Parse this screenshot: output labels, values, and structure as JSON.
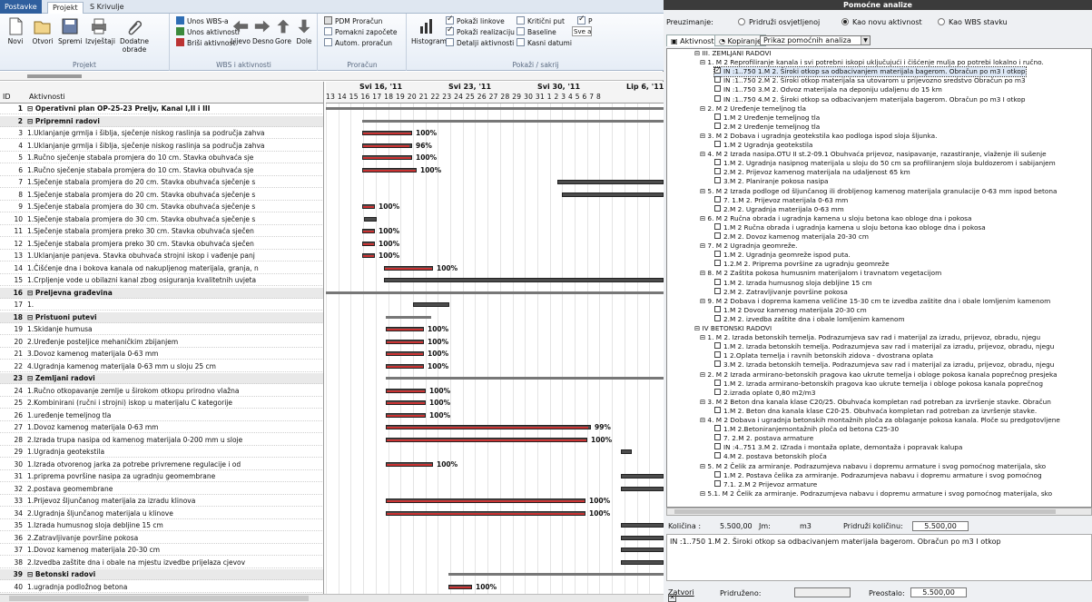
{
  "ribbon": {
    "tabs": [
      "Postavke",
      "Projekt",
      "S Krivulje"
    ],
    "groups": {
      "projekt": {
        "label": "Projekt",
        "buttons": [
          "Novi",
          "Otvori",
          "Spremi",
          "Izvještaji",
          "Dodatne obrade"
        ]
      },
      "wbs": {
        "label": "WBS i aktivnosti",
        "small": [
          "Unos WBS-a",
          "Unos aktivnosti",
          "Briši aktivnost"
        ],
        "buttons": [
          "Lijevo",
          "Desno",
          "Gore",
          "Dole"
        ]
      },
      "proracun": {
        "label": "Proračun",
        "small": [
          "PDM Proračun",
          "Pomakni započete",
          "Autom. proračun"
        ]
      },
      "prikazi": {
        "label": "Pokaži / sakrij",
        "histogram": "Histogram",
        "checks": [
          {
            "label": "Pokaži linkove",
            "on": true
          },
          {
            "label": "Kritični put",
            "on": false
          },
          {
            "label": "P",
            "on": true
          },
          {
            "label": "Pokaži realizaciju",
            "on": true
          },
          {
            "label": "Baseline",
            "on": false
          },
          {
            "label": "Detalji aktivnosti",
            "on": false
          },
          {
            "label": "Kasni datumi",
            "on": false
          }
        ],
        "truncated": "Sve a"
      }
    }
  },
  "grid": {
    "col_id": "ID",
    "col_name": "Aktivnosti",
    "weeks": [
      "Svi 16, '11",
      "Svi 23, '11",
      "Svi 30, '11",
      "Lip 6, '11"
    ],
    "days": "13 14 15 16 17 18 19 20 21 22 23 24 25 26 27 28 29 30 31 1 2 3 4 5 6 7 8",
    "rows": [
      {
        "id": "1",
        "name": "⊟ Operativni plan  OP-25-23 Preljv, Kanal I,II i III",
        "sum": false,
        "bold": true
      },
      {
        "id": "2",
        "name": "   ⊟ Pripremni radovi",
        "sum": true
      },
      {
        "id": "3",
        "name": "          1.Uklanjanje grmlja i šiblja, sječenje niskog raslinja sa područja zahva",
        "pct": "100%"
      },
      {
        "id": "4",
        "name": "          1.Uklanjanje grmlja i šiblja, sječenje niskog raslinja sa područja zahva",
        "pct": "96%"
      },
      {
        "id": "5",
        "name": "          1.Ručno sječenje stabala promjera do 10 cm. Stavka obuhvaća sje",
        "pct": "100%"
      },
      {
        "id": "6",
        "name": "          1.Ručno sječenje stabala promjera do 10 cm. Stavka obuhvaća sje",
        "pct": "100%"
      },
      {
        "id": "7",
        "name": "          1.Sječenje stabala promjera do 20 cm. Stavka obuhvaća sječenje s"
      },
      {
        "id": "8",
        "name": "          1.Sječenje stabala promjera do 20 cm. Stavka obuhvaća sječenje s"
      },
      {
        "id": "9",
        "name": "          1.Sječenje stabala promjera do 30 cm. Stavka obuhvaća sječenje s",
        "pct": "100%"
      },
      {
        "id": "10",
        "name": "          1.Sječenje stabala promjera do 30 cm. Stavka obuhvaća sječenje s"
      },
      {
        "id": "11",
        "name": "          1.Sječenje stabala promjera preko 30 cm. Stavka obuhvaća sječen",
        "pct": "100%"
      },
      {
        "id": "12",
        "name": "          1.Sječenje stabala promjera preko 30 cm. Stavka obuhvaća sječen",
        "pct": "100%"
      },
      {
        "id": "13",
        "name": "          1.Uklanjanje panjeva. Stavka obuhvaća strojni iskop i vađenje panj",
        "pct": "100%"
      },
      {
        "id": "14",
        "name": "          1.Čišćenje dna i bokova kanala od nakupljenog materijala, granja, n",
        "pct": "100%"
      },
      {
        "id": "15",
        "name": "          1.Crpljenje vode u obilazni kanal zbog osiguranja kvalitetnih uvjeta"
      },
      {
        "id": "16",
        "name": "⊟ Preljevna građevina",
        "sum": true
      },
      {
        "id": "17",
        "name": "          1."
      },
      {
        "id": "18",
        "name": "      ⊟ Pristuoni putevi",
        "sum": true
      },
      {
        "id": "19",
        "name": "               1.Skidanje humusa",
        "pct": "100%"
      },
      {
        "id": "20",
        "name": "               2.Uređenje posteljice mehaničkim zbijanjem",
        "pct": "100%"
      },
      {
        "id": "21",
        "name": "               3.Dovoz kamenog materijala 0-63 mm",
        "pct": "100%"
      },
      {
        "id": "22",
        "name": "               4.Ugradnja kamenog materijala 0-63 mm u sloju 25 cm",
        "pct": "100%"
      },
      {
        "id": "23",
        "name": "      ⊟ Zemljani radovi",
        "sum": true
      },
      {
        "id": "24",
        "name": "               1.Ručno otkopavanje zemlje u širokom otkopu prirodno vlažna",
        "pct": "100%"
      },
      {
        "id": "25",
        "name": "               2.Kombinirani (ručni i strojni) iskop u materijalu  C  kategorije",
        "pct": "100%"
      },
      {
        "id": "26",
        "name": "               1.uređenje temeljnog tla",
        "pct": "100%"
      },
      {
        "id": "27",
        "name": "               1.Dovoz kamenog materijala 0-63 mm",
        "pct": "99%"
      },
      {
        "id": "28",
        "name": "               2.Izrada trupa nasipa od kamenog materijala 0-200 mm u sloje",
        "pct": "100%"
      },
      {
        "id": "29",
        "name": "               1.Ugradnja geotekstila"
      },
      {
        "id": "30",
        "name": "               1.Izrada otvorenog jarka za potrebe privremene regulacije i od",
        "pct": "100%"
      },
      {
        "id": "31",
        "name": "               1.priprema površine nasipa za ugradnju geomembrane"
      },
      {
        "id": "32",
        "name": "               2.postava geomembrane"
      },
      {
        "id": "33",
        "name": "               1.Prijevoz šljunčanog materijala za izradu klinova",
        "pct": "100%"
      },
      {
        "id": "34",
        "name": "               2.Ugradnja šljunčanog materijala u klinove",
        "pct": "100%"
      },
      {
        "id": "35",
        "name": "               1.Izrada humusnog sloja debljine 15 cm"
      },
      {
        "id": "36",
        "name": "               2.Zatravljivanje površine pokosa"
      },
      {
        "id": "37",
        "name": "               1.Dovoz kamenog materijala 20-30 cm"
      },
      {
        "id": "38",
        "name": "               2.Izvedba zaštite dna i obale na mjestu izvedbe prijelaza cjevov"
      },
      {
        "id": "39",
        "name": "      ⊟ Betonski radovi",
        "sum": true
      },
      {
        "id": "40",
        "name": "               1.ugradnja podložnog betona",
        "pct": "100%"
      }
    ]
  },
  "panel": {
    "title": "Pomoćne analize",
    "preuzimanje": "Preuzimanje:",
    "radios": [
      {
        "label": "Pridruži osvjetljenoj",
        "on": false
      },
      {
        "label": "Kao novu aktivnost",
        "on": true
      },
      {
        "label": "Kao WBS stavku",
        "on": false
      }
    ],
    "tabs": [
      "Aktivnosti",
      "Kopiranje"
    ],
    "select": "Prikaz pomoćnih analiza",
    "tree": [
      {
        "t": "⊟ III. ZEMLJANI RADOVI",
        "lv": 1,
        "ex": true
      },
      {
        "t": "⊟ 1. M 2  Reprofiliranje kanala i svi potrebni iskopi uključujući i čišćenje mulja po potrebi lokalno i ručno.",
        "lv": 2
      },
      {
        "t": "IN :1..750 1.M 2. Široki otkop sa odbacivanjem materijala bagerom. Obračun po m3  I otkop",
        "lv": 3,
        "cb": true,
        "on": true,
        "hl": true
      },
      {
        "t": "IN :1..750 2.M 2. Široki otkop materijala sa utovarom u prijevozno sredstvo Obračun po m3",
        "lv": 3,
        "cb": true
      },
      {
        "t": "IN :1..750 3.M 2. Odvoz materijala na deponiju udaljenu do 15 km",
        "lv": 3,
        "cb": true
      },
      {
        "t": "IN :1..750 4.M 2. Široki otkop sa odbacivanjem materijala bagerom. Obračun po m3  I otkop",
        "lv": 3,
        "cb": true
      },
      {
        "t": "⊟ 2. M 2  Uređenje temeljnog tla",
        "lv": 2
      },
      {
        "t": "1.M 2  Uređenje temeljnog tla",
        "lv": 3,
        "cb": true
      },
      {
        "t": "2.M 2  Uređenje temeljnog tla",
        "lv": 3,
        "cb": true
      },
      {
        "t": "⊟ 3. M 2  Dobava i ugradnja geotekstila kao podloga ispod sloja šljunka.",
        "lv": 2
      },
      {
        "t": "1.M 2  Ugradnja geotekstila",
        "lv": 3,
        "cb": true
      },
      {
        "t": "⊟ 4. M 2  Izrada nasipa.OTU II st.2-09.1 Obuhvaća prijevoz, nasipavanje, razastiranje, vlaženje ili sušenje",
        "lv": 2
      },
      {
        "t": "1.M 2. Ugradnja nasipnog materijala u sloju do 50 cm sa profiliranjem sloja buldozerom i sabijanjem",
        "lv": 3,
        "cb": true
      },
      {
        "t": "2.M 2. Prijevoz kamenog materijala na udaljenost 65 km",
        "lv": 3,
        "cb": true
      },
      {
        "t": "3.M 2. Planiranje  pokosa nasipa",
        "lv": 3,
        "cb": true
      },
      {
        "t": "⊟ 5. M 2  Izrada podloge od šljunčanog ili drobljenog kamenog materijala granulacije 0-63 mm ispod betona",
        "lv": 2
      },
      {
        "t": "7. 1.M 2. Prijevoz materijala 0-63 mm",
        "lv": 3,
        "cb": true
      },
      {
        "t": "2.M 2. Ugradnja materijala 0-63 mm",
        "lv": 3,
        "cb": true
      },
      {
        "t": "⊟ 6. M 2  Ručna obrada i ugradnja kamena u sloju betona kao obloge dna i pokosa",
        "lv": 2
      },
      {
        "t": "1.M 2 Ručna obrada i ugradnja kamena u sloju betona kao obloge dna i pokosa",
        "lv": 3,
        "cb": true
      },
      {
        "t": "2.M 2. Dovoz kamenog materijala 20-30 cm",
        "lv": 3,
        "cb": true
      },
      {
        "t": "⊟ 7. M 2  Ugradnja geomreže.",
        "lv": 2
      },
      {
        "t": "1.M 2. Ugradnja geomreže ispod puta.",
        "lv": 3,
        "cb": true
      },
      {
        "t": "1.2.M 2. Priprema površine za ugradnju geomreže",
        "lv": 3,
        "cb": true
      },
      {
        "t": "⊟ 8. M 2  Zaštita pokosa humusnim materijalom i travnatom vegetacijom",
        "lv": 2
      },
      {
        "t": "1.M 2. Izrada humusnog sloja debljine 15 cm",
        "lv": 3,
        "cb": true
      },
      {
        "t": "2.M 2. Zatravljivanje površine pokosa",
        "lv": 3,
        "cb": true
      },
      {
        "t": "⊟ 9. M 2  Dobava i doprema kamena veličine 15-30 cm te izvedba zaštite dna i obale lomljenim kamenom",
        "lv": 2
      },
      {
        "t": "1.M 2 Dovoz kamenog materijala 20-30 cm",
        "lv": 3,
        "cb": true
      },
      {
        "t": "2.M 2. izvedba zaštite dna i obale lomljenim kamenom",
        "lv": 3,
        "cb": true
      },
      {
        "t": "⊟ IV BETONSKI RADOVI",
        "lv": 1
      },
      {
        "t": "⊟ 1. M 2.  Izrada betonskih temelja. Podrazumjeva sav rad i materijal za izradu, prijevoz, obradu, njegu",
        "lv": 2
      },
      {
        "t": "1.M 2. Izrada betonskih temelja. Podrazumjeva sav rad i materijal za izradu, prijevoz, obradu, njegu",
        "lv": 3,
        "cb": true
      },
      {
        "t": "1 2.Oplata temelja i ravnih betonskih zidova - dvostrana oplata",
        "lv": 3,
        "cb": true
      },
      {
        "t": "3.M 2. Izrada betonskih temelja. Podrazumjeva sav rad i materijal za izradu, prijevoz, obradu, njegu",
        "lv": 3,
        "cb": true
      },
      {
        "t": "⊟ 2. M 2  Izrada armirano-betonskih pragova kao ukrute temelja i obloge pokosa kanala poprečnog presjeka",
        "lv": 2
      },
      {
        "t": "1.M 2. Izrada armirano-betonskih pragova kao ukrute temelja i obloge pokosa kanala poprečnog",
        "lv": 3,
        "cb": true
      },
      {
        "t": "2.izrada oplate 0,80 m2/m3",
        "lv": 3,
        "cb": true
      },
      {
        "t": "⊟ 3. M 2  Beton dna kanala klase C20/25. Obuhvaća kompletan rad potreban za izvršenje stavke. Obračun",
        "lv": 2
      },
      {
        "t": "1.M 2. Beton dna kanala klase C20-25. Obuhvaća kompletan rad potreban za izvršenje stavke.",
        "lv": 3,
        "cb": true
      },
      {
        "t": "⊟ 4. M 2 Dobava i ugradnja betonskih montažnih ploča za oblaganje pokosa kanala. Ploče su predgotovljene",
        "lv": 2
      },
      {
        "t": "1.M 2.Betoniranjemontažnih ploča od betona C25-30",
        "lv": 3,
        "cb": true
      },
      {
        "t": "7. 2.M 2. postava armature",
        "lv": 3,
        "cb": true
      },
      {
        "t": "IN :4..751 3.M 2. IZrada i montaža oplate, demontaža i popravak kalupa",
        "lv": 3,
        "cb": true
      },
      {
        "t": "4.M 2. postava betonskih ploča",
        "lv": 3,
        "cb": true
      },
      {
        "t": "⊟ 5. M 2 Čelik za armiranje. Podrazumjeva nabavu i dopremu armature i svog pomoćnog materijala, sko",
        "lv": 2
      },
      {
        "t": "1.M 2. Postava čelika za armiranje. Podrazumjeva nabavu i dopremu armature i svog pomoćnog",
        "lv": 3,
        "cb": true
      },
      {
        "t": "7.1. 2.M 2 Prijevoz armature",
        "lv": 3,
        "cb": true
      },
      {
        "t": "⊟ 5.1. M 2 Čelik za armiranje. Podrazumjeva nabavu i dopremu armature i svog pomoćnog materijala, sko",
        "lv": 2
      }
    ],
    "kolicina_label": "Količina :",
    "kolicina": "5.500,00",
    "jm_label": "Jm:",
    "jm": "m3",
    "pridruzi_label": "Pridruži količinu:",
    "pridruzi": "5.500,00",
    "description": "IN :1..750 1.M 2. Široki otkop sa odbacivanjem materijala bagerom. Obračun po m3  I otkop",
    "close": "Zatvori",
    "pridruzeno_label": "Pridruženo:",
    "preostalo_label": "Preostalo:",
    "preostalo": "5.500,00"
  }
}
